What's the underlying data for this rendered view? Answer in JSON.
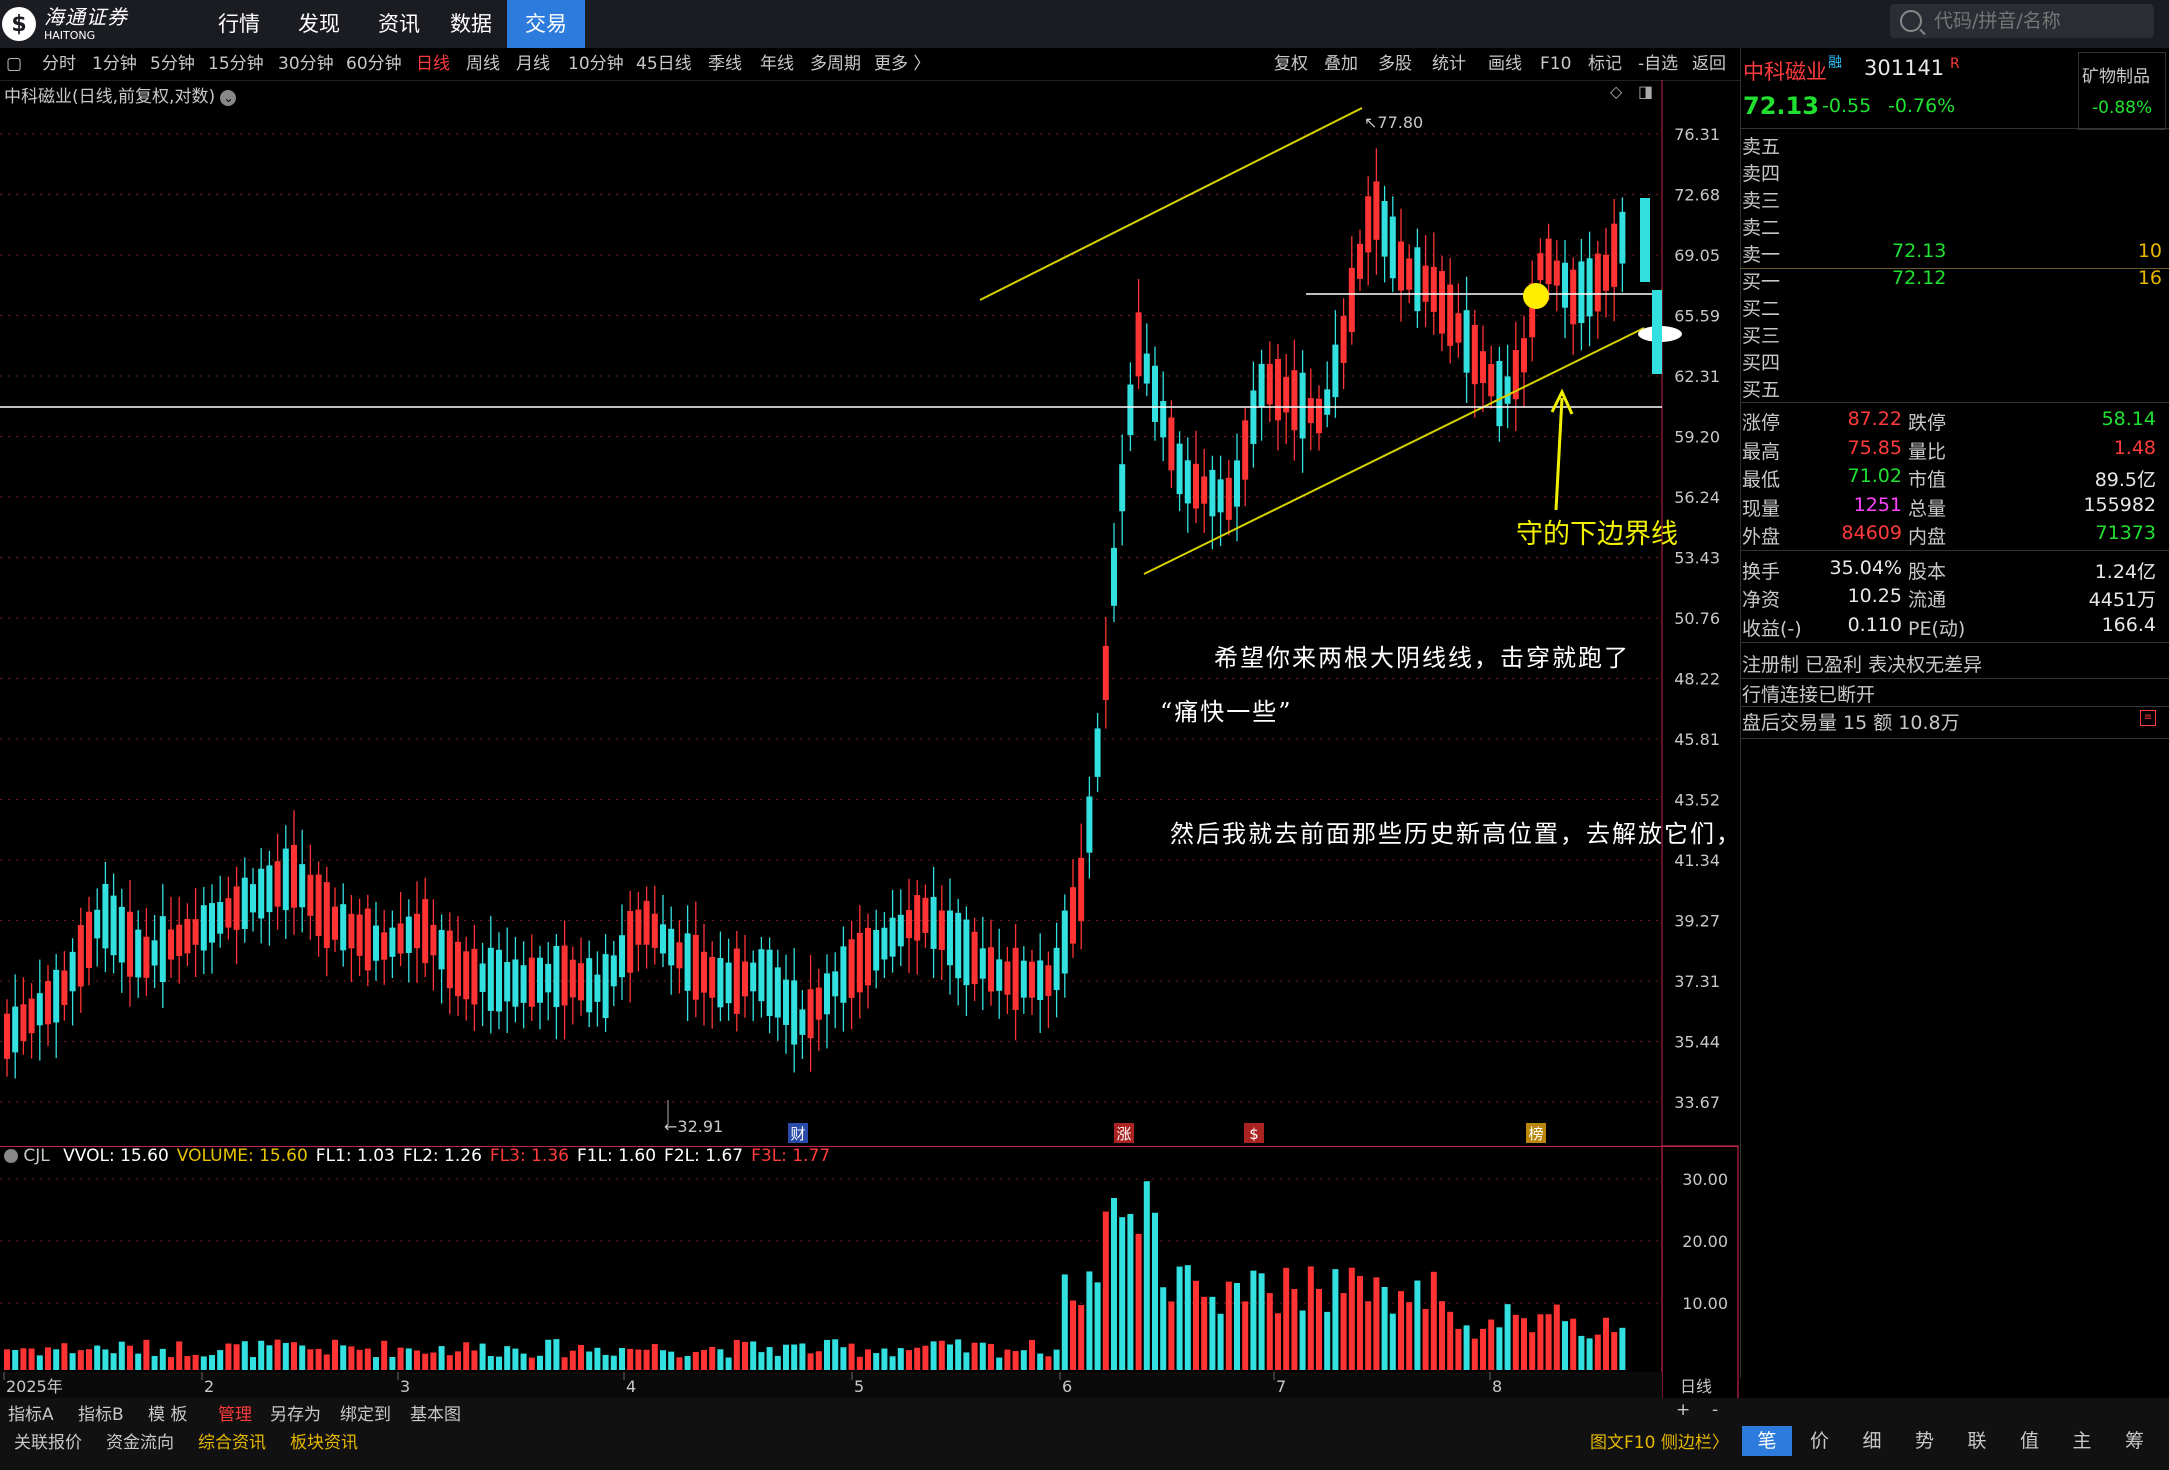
{
  "app": {
    "logo_cn": "海通证券",
    "logo_en": "HAITONG",
    "nav": [
      "行情",
      "发现",
      "资讯",
      "数据",
      "交易"
    ],
    "nav_active": 4,
    "search_placeholder": "代码/拼音/名称"
  },
  "periods": [
    "分时",
    "1分钟",
    "5分钟",
    "15分钟",
    "30分钟",
    "60分钟",
    "日线",
    "周线",
    "月线",
    "10分钟",
    "45日线",
    "季线",
    "年线",
    "多周期",
    "更多 〉"
  ],
  "period_active": "日线",
  "tools": [
    "复权",
    "叠加",
    "多股",
    "统计",
    "画线",
    "F10",
    "标记",
    "-自选",
    "返回"
  ],
  "chart_title": "中科磁业(日线,前复权,对数)",
  "y_axis_labels": [
    "76.31",
    "72.68",
    "69.05",
    "65.59",
    "62.31",
    "59.20",
    "56.24",
    "53.43",
    "50.76",
    "48.22",
    "45.81",
    "43.52",
    "41.34",
    "39.27",
    "37.31",
    "35.44",
    "33.67"
  ],
  "high_marker": "77.80",
  "low_marker": "32.91",
  "event_marks": [
    "财",
    "涨",
    "$",
    "榜"
  ],
  "annotations": {
    "lower_line": "守的下边界线",
    "text1": "希望你来两根大阴线线，击穿就跑了",
    "text2": "“痛快一些”",
    "text3": "然后我就去前面那些历史新高位置，去解放它们，站好“岗”"
  },
  "indicator": {
    "name": "CJL",
    "items": [
      {
        "label": "VVOL: 15.60",
        "color": "#ffffff"
      },
      {
        "label": "VOLUME: 15.60",
        "color": "#e6c200"
      },
      {
        "label": "FL1: 1.03",
        "color": "#ffffff"
      },
      {
        "label": "FL2: 1.26",
        "color": "#ffffff"
      },
      {
        "label": "FL3: 1.36",
        "color": "#ff3b3b"
      },
      {
        "label": "F1L: 1.60",
        "color": "#ffffff"
      },
      {
        "label": "F2L: 1.67",
        "color": "#ffffff"
      },
      {
        "label": "F3L: 1.77",
        "color": "#ff3b3b"
      }
    ],
    "y_labels": [
      "30.00",
      "20.00",
      "10.00"
    ]
  },
  "x_axis": {
    "labels": [
      "2025年",
      "2",
      "3",
      "4",
      "5",
      "6",
      "7",
      "8"
    ],
    "right_label": "日线"
  },
  "stock": {
    "name": "中科磁业",
    "tag": "融",
    "code": "301141",
    "code_suffix": "R",
    "price": "72.13",
    "change": "-0.55",
    "change_pct": "-0.76%",
    "sector": "矿物制品",
    "sector_pct": "-0.88%"
  },
  "order_book": {
    "sells": [
      {
        "label": "卖五",
        "price": "",
        "vol": ""
      },
      {
        "label": "卖四",
        "price": "",
        "vol": ""
      },
      {
        "label": "卖三",
        "price": "",
        "vol": ""
      },
      {
        "label": "卖二",
        "price": "",
        "vol": ""
      },
      {
        "label": "卖一",
        "price": "72.13",
        "vol": "10"
      }
    ],
    "buys": [
      {
        "label": "买一",
        "price": "72.12",
        "vol": "16"
      },
      {
        "label": "买二",
        "price": "",
        "vol": ""
      },
      {
        "label": "买三",
        "price": "",
        "vol": ""
      },
      {
        "label": "买四",
        "price": "",
        "vol": ""
      },
      {
        "label": "买五",
        "price": "",
        "vol": ""
      }
    ]
  },
  "stats": [
    {
      "l1": "涨停",
      "v1": "87.22",
      "c1": "red",
      "l2": "跌停",
      "v2": "58.14",
      "c2": "green"
    },
    {
      "l1": "最高",
      "v1": "75.85",
      "c1": "red",
      "l2": "量比",
      "v2": "1.48",
      "c2": "red"
    },
    {
      "l1": "最低",
      "v1": "71.02",
      "c1": "green",
      "l2": "市值",
      "v2": "89.5亿",
      "c2": "white"
    },
    {
      "l1": "现量",
      "v1": "1251",
      "c1": "mag",
      "l2": "总量",
      "v2": "155982",
      "c2": "white"
    },
    {
      "l1": "外盘",
      "v1": "84609",
      "c1": "red",
      "l2": "内盘",
      "v2": "71373",
      "c2": "green"
    },
    {
      "l1": "换手",
      "v1": "35.04%",
      "c1": "white",
      "l2": "股本",
      "v2": "1.24亿",
      "c2": "white"
    },
    {
      "l1": "净资",
      "v1": "10.25",
      "c1": "white",
      "l2": "流通",
      "v2": "4451万",
      "c2": "white"
    },
    {
      "l1": "收益(-)",
      "v1": "0.110",
      "c1": "white",
      "l2": "PE(动)",
      "v2": "166.4",
      "c2": "white"
    }
  ],
  "status": {
    "line1": "注册制 已盈利 表决权无差异",
    "line2": "行情连接已断开",
    "line3": "盘后交易量 15 额 10.8万"
  },
  "bottom_row1": [
    "指标A",
    "指标B",
    "模 板",
    "管理",
    "另存为",
    "绑定到",
    "基本图"
  ],
  "bottom_row1_active": "管理",
  "bottom_row2": [
    "关联报价",
    "资金流向",
    "综合资讯",
    "板块资讯"
  ],
  "bottom_row2_gold": [
    "综合资讯",
    "板块资讯"
  ],
  "bottom_right": "图文F10 侧边栏〉",
  "right_tabs": [
    "笔",
    "价",
    "细",
    "势",
    "联",
    "值",
    "主",
    "筹"
  ],
  "right_tab_active": "笔"
}
